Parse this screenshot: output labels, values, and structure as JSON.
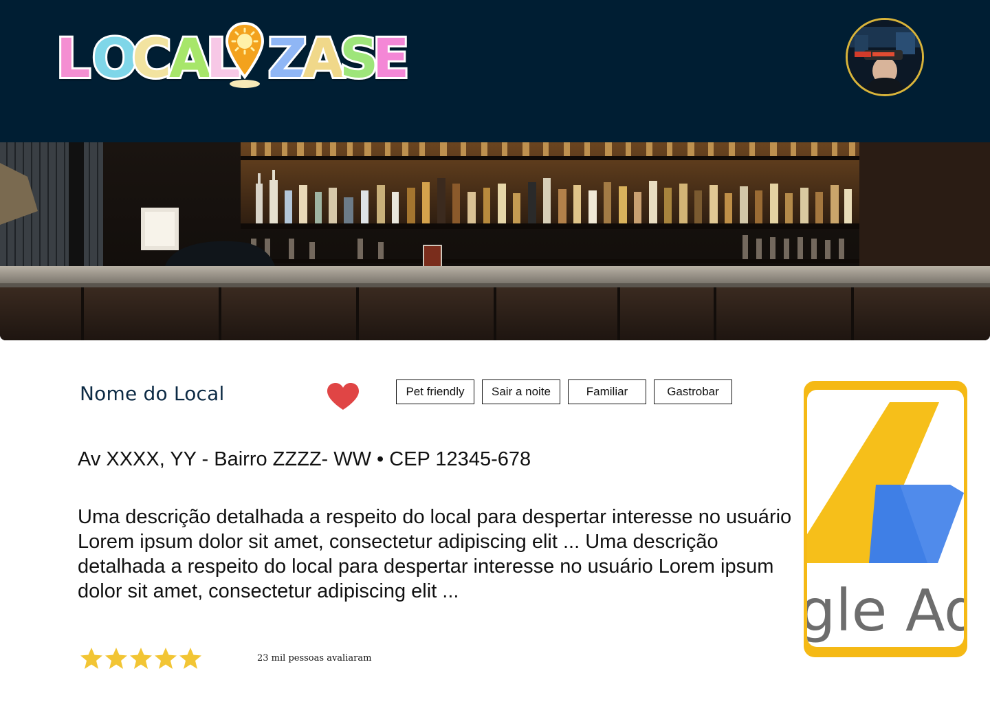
{
  "header": {
    "logo_text": "LOCALIZASE",
    "avatar_alt": "profile"
  },
  "place": {
    "name": "Nome do Local",
    "tags": [
      "Pet friendly",
      "Sair a noite",
      "Familiar",
      "Gastrobar"
    ],
    "address": "Av XXXX, YY - Bairro ZZZZ- WW • CEP 12345-678",
    "description": "Uma descrição detalhada a respeito do local para despertar interesse no usuário Lorem ipsum dolor sit amet, consectetur adipiscing elit ... Uma descrição detalhada a respeito do local para despertar interesse no usuário Lorem ipsum dolor sit amet, consectetur adipiscing elit ...",
    "rating_stars": 5,
    "rating_max": 5,
    "rating_text": "23 mil pessoas avaliaram"
  },
  "ad": {
    "text": "gle AdS"
  },
  "colors": {
    "header_bg": "#001e33",
    "heart": "#e04545",
    "star": "#f2c534",
    "ad_frame": "#f5b915"
  },
  "icons": {
    "favorite": "heart-icon",
    "rating": "star-icon"
  }
}
